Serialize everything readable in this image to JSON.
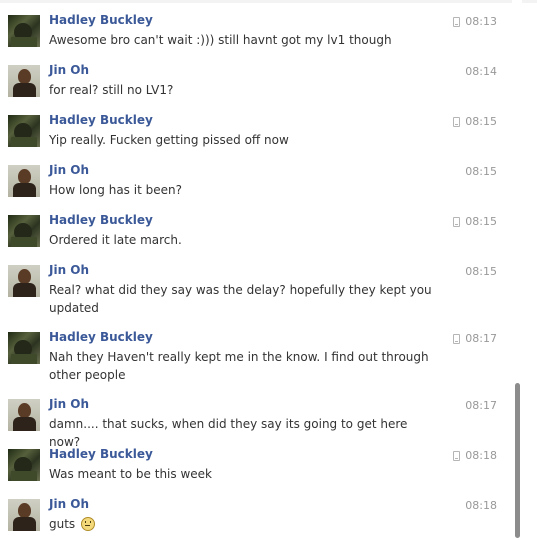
{
  "messages": [
    {
      "sender": "Hadley Buckley",
      "avatar": "hadley",
      "mobile": true,
      "time": "08:13",
      "text": "Awesome bro can't wait :))) still havnt got my lv1 though"
    },
    {
      "sender": "Jin Oh",
      "avatar": "jin",
      "mobile": false,
      "time": "08:14",
      "text": "for real? still no LV1?"
    },
    {
      "sender": "Hadley Buckley",
      "avatar": "hadley",
      "mobile": true,
      "time": "08:15",
      "text": "Yip really. Fucken getting pissed off now"
    },
    {
      "sender": "Jin Oh",
      "avatar": "jin",
      "mobile": false,
      "time": "08:15",
      "text": "How long has it been?"
    },
    {
      "sender": "Hadley Buckley",
      "avatar": "hadley",
      "mobile": true,
      "time": "08:15",
      "text": "Ordered it late march."
    },
    {
      "sender": "Jin Oh",
      "avatar": "jin",
      "mobile": false,
      "time": "08:15",
      "text": "Real? what did they say was the delay? hopefully they kept you updated"
    },
    {
      "sender": "Hadley Buckley",
      "avatar": "hadley",
      "mobile": true,
      "time": "08:17",
      "text": "Nah they Haven't really kept me in the know. I find out through other people"
    },
    {
      "sender": "Jin Oh",
      "avatar": "jin",
      "mobile": false,
      "time": "08:17",
      "text": "damn.... that sucks, when did they say its going to get here now?"
    },
    {
      "sender": "Hadley Buckley",
      "avatar": "hadley",
      "mobile": true,
      "time": "08:18",
      "text": "Was meant to be this week"
    },
    {
      "sender": "Jin Oh",
      "avatar": "jin",
      "mobile": false,
      "time": "08:18",
      "text": "guts",
      "emoji": "frown-emoji"
    }
  ]
}
